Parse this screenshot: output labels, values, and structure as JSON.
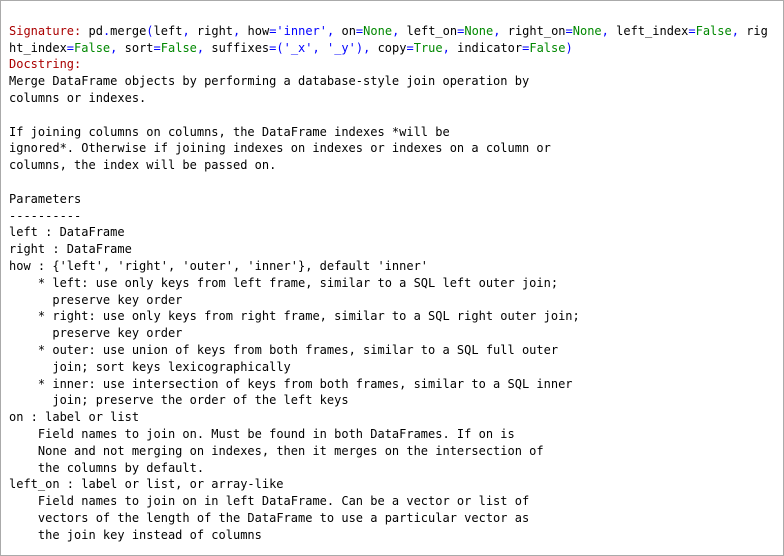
{
  "signature": {
    "label": "Signature: ",
    "tokens": [
      {
        "t": "pd",
        "c": "black"
      },
      {
        "t": ".",
        "c": "blue"
      },
      {
        "t": "merge",
        "c": "black"
      },
      {
        "t": "(",
        "c": "blue"
      },
      {
        "t": "left",
        "c": "black"
      },
      {
        "t": ",",
        "c": "blue"
      },
      {
        "t": " ",
        "c": "black"
      },
      {
        "t": "right",
        "c": "black"
      },
      {
        "t": ",",
        "c": "blue"
      },
      {
        "t": " ",
        "c": "black"
      },
      {
        "t": "how",
        "c": "black"
      },
      {
        "t": "=",
        "c": "blue"
      },
      {
        "t": "'inner'",
        "c": "blue"
      },
      {
        "t": ",",
        "c": "blue"
      },
      {
        "t": " ",
        "c": "black"
      },
      {
        "t": "on",
        "c": "black"
      },
      {
        "t": "=",
        "c": "blue"
      },
      {
        "t": "None",
        "c": "green"
      },
      {
        "t": ",",
        "c": "blue"
      },
      {
        "t": " ",
        "c": "black"
      },
      {
        "t": "left_on",
        "c": "black"
      },
      {
        "t": "=",
        "c": "blue"
      },
      {
        "t": "None",
        "c": "green"
      },
      {
        "t": ",",
        "c": "blue"
      },
      {
        "t": " ",
        "c": "black"
      },
      {
        "t": "right_on",
        "c": "black"
      },
      {
        "t": "=",
        "c": "blue"
      },
      {
        "t": "None",
        "c": "green"
      },
      {
        "t": ",",
        "c": "blue"
      },
      {
        "t": " ",
        "c": "black"
      },
      {
        "t": "left_index",
        "c": "black"
      },
      {
        "t": "=",
        "c": "blue"
      },
      {
        "t": "False",
        "c": "green"
      },
      {
        "t": ",",
        "c": "blue"
      },
      {
        "t": " ",
        "c": "black"
      },
      {
        "t": "right_index",
        "c": "black"
      },
      {
        "t": "=",
        "c": "blue"
      },
      {
        "t": "False",
        "c": "green"
      },
      {
        "t": ",",
        "c": "blue"
      },
      {
        "t": " ",
        "c": "black"
      },
      {
        "t": "sort",
        "c": "black"
      },
      {
        "t": "=",
        "c": "blue"
      },
      {
        "t": "False",
        "c": "green"
      },
      {
        "t": ",",
        "c": "blue"
      },
      {
        "t": " ",
        "c": "black"
      },
      {
        "t": "suffixes",
        "c": "black"
      },
      {
        "t": "=(",
        "c": "blue"
      },
      {
        "t": "'_x'",
        "c": "blue"
      },
      {
        "t": ",",
        "c": "blue"
      },
      {
        "t": " ",
        "c": "black"
      },
      {
        "t": "'_y'",
        "c": "blue"
      },
      {
        "t": "),",
        "c": "blue"
      },
      {
        "t": " ",
        "c": "black"
      },
      {
        "t": "copy",
        "c": "black"
      },
      {
        "t": "=",
        "c": "blue"
      },
      {
        "t": "True",
        "c": "green"
      },
      {
        "t": ",",
        "c": "blue"
      },
      {
        "t": " ",
        "c": "black"
      },
      {
        "t": "indicator",
        "c": "black"
      },
      {
        "t": "=",
        "c": "blue"
      },
      {
        "t": "False",
        "c": "green"
      },
      {
        "t": ")",
        "c": "blue"
      }
    ]
  },
  "docstring_label": "Docstring:",
  "body_text": "Merge DataFrame objects by performing a database-style join operation by\ncolumns or indexes.\n\nIf joining columns on columns, the DataFrame indexes *will be\nignored*. Otherwise if joining indexes on indexes or indexes on a column or\ncolumns, the index will be passed on.\n\nParameters\n----------\nleft : DataFrame\nright : DataFrame\nhow : {'left', 'right', 'outer', 'inner'}, default 'inner'\n    * left: use only keys from left frame, similar to a SQL left outer join;\n      preserve key order\n    * right: use only keys from right frame, similar to a SQL right outer join;\n      preserve key order\n    * outer: use union of keys from both frames, similar to a SQL full outer\n      join; sort keys lexicographically\n    * inner: use intersection of keys from both frames, similar to a SQL inner\n      join; preserve the order of the left keys\non : label or list\n    Field names to join on. Must be found in both DataFrames. If on is\n    None and not merging on indexes, then it merges on the intersection of\n    the columns by default.\nleft_on : label or list, or array-like\n    Field names to join on in left DataFrame. Can be a vector or list of\n    vectors of the length of the DataFrame to use a particular vector as\n    the join key instead of columns"
}
